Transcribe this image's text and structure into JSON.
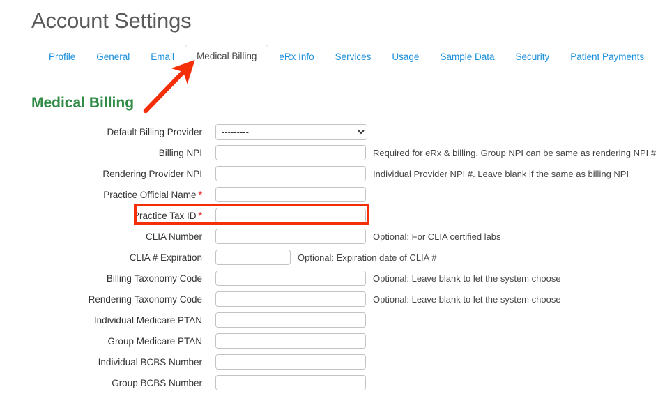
{
  "page": {
    "title": "Account Settings",
    "section_heading": "Medical Billing"
  },
  "tabs": [
    {
      "label": "Profile",
      "active": false
    },
    {
      "label": "General",
      "active": false
    },
    {
      "label": "Email",
      "active": false
    },
    {
      "label": "Medical Billing",
      "active": true
    },
    {
      "label": "eRx Info",
      "active": false
    },
    {
      "label": "Services",
      "active": false
    },
    {
      "label": "Usage",
      "active": false
    },
    {
      "label": "Sample Data",
      "active": false
    },
    {
      "label": "Security",
      "active": false
    },
    {
      "label": "Patient Payments",
      "active": false
    }
  ],
  "form": {
    "fields": [
      {
        "label": "Default Billing Provider",
        "required": false,
        "type": "select",
        "value": "---------",
        "options": [
          "---------"
        ],
        "help": ""
      },
      {
        "label": "Billing NPI",
        "required": false,
        "type": "text",
        "value": "",
        "help": "Required for eRx & billing. Group NPI can be same as rendering NPI #"
      },
      {
        "label": "Rendering Provider NPI",
        "required": false,
        "type": "text",
        "value": "",
        "help": "Individual Provider NPI #. Leave blank if the same as billing NPI"
      },
      {
        "label": "Practice Official Name",
        "required": true,
        "type": "text",
        "value": "",
        "help": ""
      },
      {
        "label": "Practice Tax ID",
        "required": true,
        "type": "text",
        "value": "",
        "help": "",
        "focused": true
      },
      {
        "label": "CLIA Number",
        "required": false,
        "type": "text",
        "value": "",
        "help": "Optional: For CLIA certified labs"
      },
      {
        "label": "CLIA # Expiration",
        "required": false,
        "type": "text-narrow",
        "value": "",
        "help": "Optional: Expiration date of CLIA #"
      },
      {
        "label": "Billing Taxonomy Code",
        "required": false,
        "type": "text",
        "value": "",
        "help": "Optional: Leave blank to let the system choose"
      },
      {
        "label": "Rendering Taxonomy Code",
        "required": false,
        "type": "text",
        "value": "",
        "help": "Optional: Leave blank to let the system choose"
      },
      {
        "label": "Individual Medicare PTAN",
        "required": false,
        "type": "text",
        "value": "",
        "help": ""
      },
      {
        "label": "Group Medicare PTAN",
        "required": false,
        "type": "text",
        "value": "",
        "help": ""
      },
      {
        "label": "Individual BCBS Number",
        "required": false,
        "type": "text",
        "value": "",
        "help": ""
      },
      {
        "label": "Group BCBS Number",
        "required": false,
        "type": "text",
        "value": "",
        "help": ""
      }
    ]
  },
  "annotations": {
    "highlight_color": "#f42f08",
    "arrow_color": "#f42f08",
    "highlight_target": "Practice Tax ID",
    "arrow_target": "Medical Billing"
  },
  "colors": {
    "tab_link": "#1b8fdb",
    "section_heading": "#2f8b45",
    "required_marker": "#e8413c",
    "title": "#5a5a5a"
  }
}
